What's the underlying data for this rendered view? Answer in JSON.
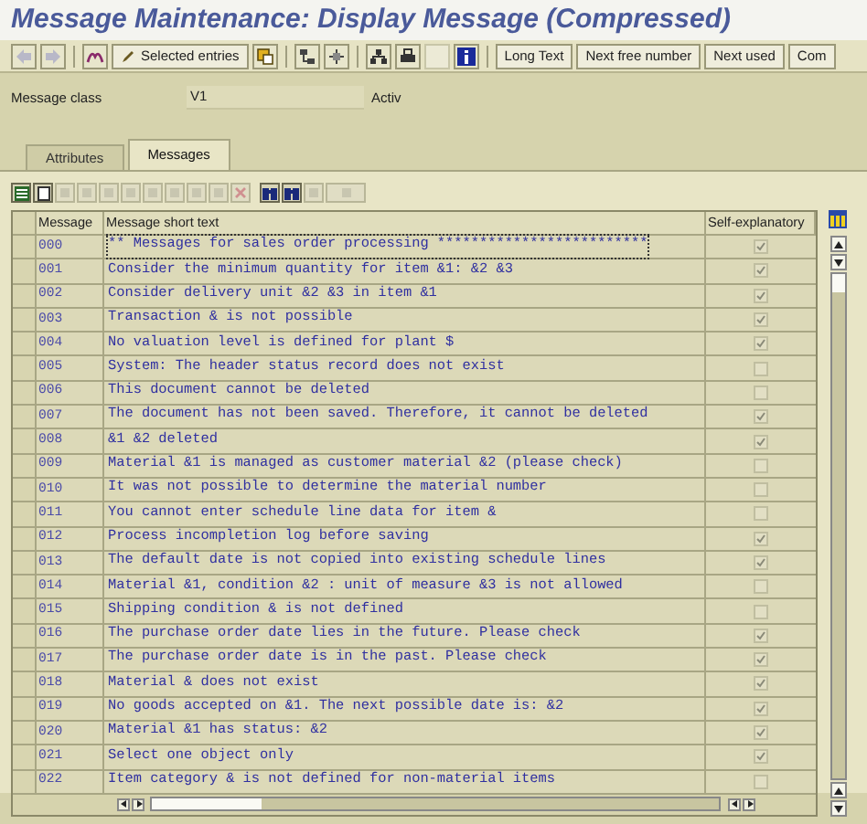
{
  "window": {
    "title": "Message Maintenance: Display Message (Compressed)"
  },
  "toolbar": {
    "buttons": [
      "Selected entries",
      "Long Text",
      "Next free number",
      "Next used",
      "Com"
    ]
  },
  "header": {
    "label": "Message class",
    "value": "V1",
    "status": "Activ"
  },
  "tabs": [
    {
      "label": "Attributes",
      "selected": false
    },
    {
      "label": "Messages",
      "selected": true
    }
  ],
  "table": {
    "columns": [
      "Message",
      "Message short text",
      "Self-explanatory"
    ],
    "rows": [
      {
        "number": "000",
        "text": "** Messages for sales order processing *************************",
        "checked": true
      },
      {
        "number": "001",
        "text": "Consider the minimum quantity for item &1: &2 &3",
        "checked": true
      },
      {
        "number": "002",
        "text": "Consider delivery unit &2 &3 in item &1",
        "checked": true
      },
      {
        "number": "003",
        "text": "Transaction & is not possible",
        "checked": true
      },
      {
        "number": "004",
        "text": "No valuation level is defined for plant $",
        "checked": true
      },
      {
        "number": "005",
        "text": "System: The header status record does not exist",
        "checked": false
      },
      {
        "number": "006",
        "text": "This document cannot be deleted",
        "checked": false
      },
      {
        "number": "007",
        "text": "The document has not been saved. Therefore, it cannot be deleted",
        "checked": true
      },
      {
        "number": "008",
        "text": "&1 &2 deleted",
        "checked": true
      },
      {
        "number": "009",
        "text": "Material &1 is managed as customer material &2 (please check)",
        "checked": false
      },
      {
        "number": "010",
        "text": "It was not possible to determine the material number",
        "checked": false
      },
      {
        "number": "011",
        "text": "You cannot enter schedule line data for item &",
        "checked": false
      },
      {
        "number": "012",
        "text": "Process incompletion log before saving",
        "checked": true
      },
      {
        "number": "013",
        "text": "The default date is not copied into existing schedule lines",
        "checked": true
      },
      {
        "number": "014",
        "text": "Material &1, condition &2 : unit of measure &3 is not allowed",
        "checked": false
      },
      {
        "number": "015",
        "text": "Shipping condition & is not defined",
        "checked": false
      },
      {
        "number": "016",
        "text": "The purchase order date lies in the future. Please check",
        "checked": true
      },
      {
        "number": "017",
        "text": "The purchase order date is in the past. Please check",
        "checked": true
      },
      {
        "number": "018",
        "text": "Material & does not exist",
        "checked": true
      },
      {
        "number": "019",
        "text": "No goods accepted on &1. The next possible date is: &2",
        "checked": true
      },
      {
        "number": "020",
        "text": "Material &1 has status: &2",
        "checked": true
      },
      {
        "number": "021",
        "text": "Select one object only",
        "checked": true
      },
      {
        "number": "022",
        "text": "Item category & is not defined for non-material items",
        "checked": false
      }
    ]
  }
}
